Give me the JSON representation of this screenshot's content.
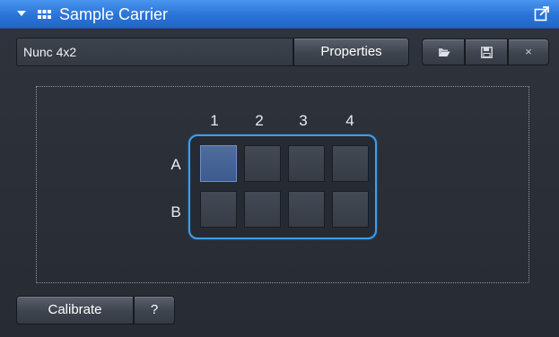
{
  "window": {
    "title": "Sample Carrier",
    "collapse_icon": "triangle-down-icon",
    "title_icon": "grid-icon",
    "undock_icon": "undock-icon"
  },
  "carrier": {
    "name": "Nunc 4x2",
    "properties_label": "Properties",
    "open_icon": "folder-open-icon",
    "save_icon": "save-icon",
    "close_label": "×"
  },
  "plate": {
    "columns": [
      "1",
      "2",
      "3",
      "4"
    ],
    "rows": [
      "A",
      "B"
    ],
    "selected_well": "A1"
  },
  "footer": {
    "calibrate_label": "Calibrate",
    "help_label": "?"
  },
  "colors": {
    "accent": "#3b9ff0",
    "titlebar": "#2a73d8",
    "selected_well": "#4f6c9c"
  }
}
